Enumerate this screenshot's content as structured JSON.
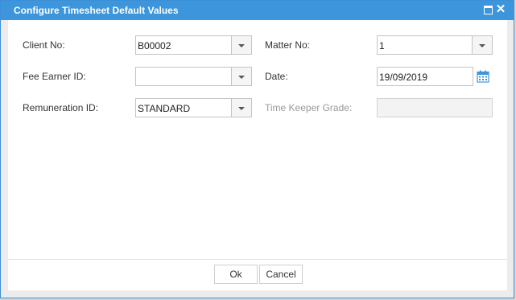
{
  "dialog": {
    "title": "Configure Timesheet Default Values",
    "maximize_icon": "maximize-icon",
    "close_icon": "close-icon"
  },
  "form": {
    "client_no": {
      "label": "Client No:",
      "value": "B00002"
    },
    "matter_no": {
      "label": "Matter No:",
      "value": "1"
    },
    "fee_earner_id": {
      "label": "Fee Earner ID:",
      "value": ""
    },
    "date": {
      "label": "Date:",
      "value": "19/09/2019",
      "icon": "calendar-icon"
    },
    "remuneration_id": {
      "label": "Remuneration ID:",
      "value": "STANDARD"
    },
    "time_keeper_grade": {
      "label": "Time Keeper Grade:",
      "value": ""
    }
  },
  "footer": {
    "ok_label": "Ok",
    "cancel_label": "Cancel"
  },
  "colors": {
    "titlebar": "#3d95db",
    "calendar": "#3d95db"
  }
}
